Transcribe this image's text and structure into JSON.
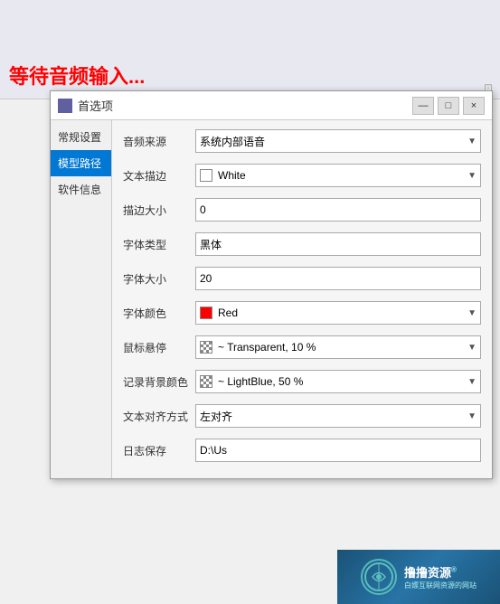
{
  "app": {
    "waiting_text": "等待音频输入...",
    "dialog_title": "首选项"
  },
  "title_bar": {
    "minimize": "—",
    "maximize": "□",
    "close": "×"
  },
  "sidebar": {
    "items": [
      {
        "id": "general",
        "label": "常规设置",
        "active": false
      },
      {
        "id": "model",
        "label": "模型路径",
        "active": true
      },
      {
        "id": "about",
        "label": "软件信息",
        "active": false
      }
    ]
  },
  "form": {
    "rows": [
      {
        "label": "音频来源",
        "type": "select",
        "value": "系统内部语音",
        "swatch": null,
        "has_arrow": true
      },
      {
        "label": "文本描边",
        "type": "select",
        "value": "White",
        "swatch": "white",
        "has_arrow": true
      },
      {
        "label": "描边大小",
        "type": "input",
        "value": "0"
      },
      {
        "label": "字体类型",
        "type": "input",
        "value": "黑体"
      },
      {
        "label": "字体大小",
        "type": "input",
        "value": "20"
      },
      {
        "label": "字体颜色",
        "type": "select",
        "value": "Red",
        "swatch": "red",
        "has_arrow": true
      },
      {
        "label": "鼠标悬停",
        "type": "select",
        "value": "~ Transparent, 10 %",
        "swatch": "checker",
        "has_arrow": true
      },
      {
        "label": "记录背景颜色",
        "type": "select",
        "value": "~ LightBlue, 50 %",
        "swatch": "checker",
        "has_arrow": true
      },
      {
        "label": "文本对齐方式",
        "type": "select",
        "value": "左对齐",
        "swatch": null,
        "has_arrow": true
      },
      {
        "label": "日志保存",
        "type": "input",
        "value": "D:\\Us"
      }
    ]
  },
  "watermark": {
    "brand": "撸撸资源",
    "reg_symbol": "®",
    "subtitle": "白嫖互联网资源的网站",
    "icon_label": "◈"
  }
}
